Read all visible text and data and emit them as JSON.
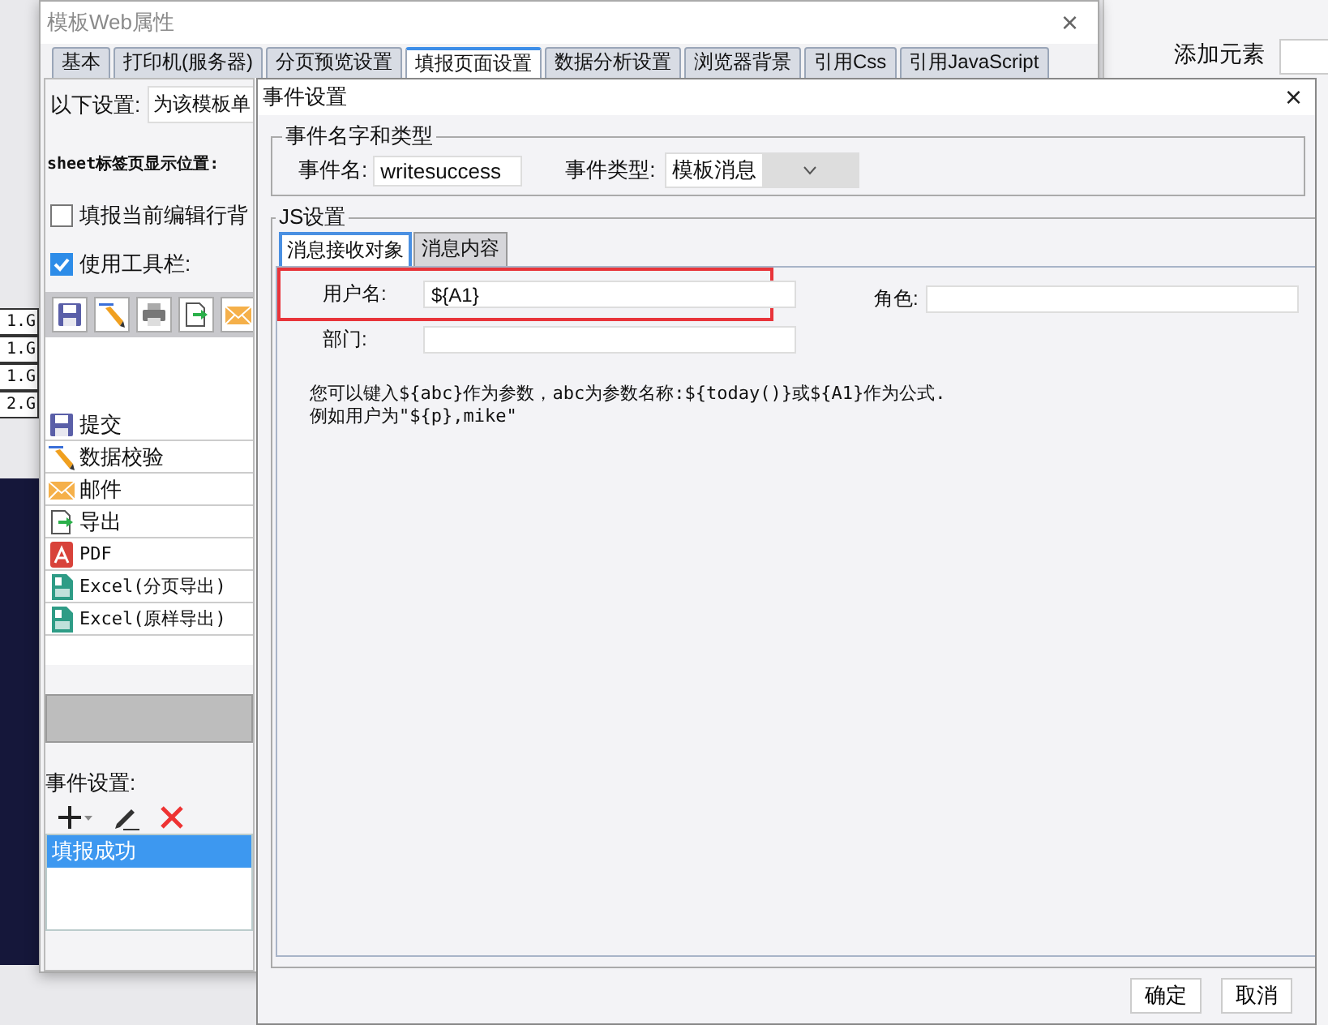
{
  "background_app": {
    "panel_label": "添加元素",
    "cells": [
      "1.G",
      "1.G",
      "1.G",
      "2.G"
    ]
  },
  "properties_window": {
    "title": "模板Web属性",
    "close_label": "×",
    "tabs": [
      {
        "label": "基本",
        "selected": false
      },
      {
        "label": "打印机(服务器)",
        "selected": false
      },
      {
        "label": "分页预览设置",
        "selected": false
      },
      {
        "label": "填报页面设置",
        "selected": true
      },
      {
        "label": "数据分析设置",
        "selected": false
      },
      {
        "label": "浏览器背景",
        "selected": false
      },
      {
        "label": "引用Css",
        "selected": false
      },
      {
        "label": "引用JavaScript",
        "selected": false
      }
    ],
    "settings_label": "以下设置:",
    "settings_value": "为该模板单",
    "sheet_position_label": "sheet标签页显示位置:",
    "checkboxes": [
      {
        "label": "填报当前编辑行背",
        "checked": false
      },
      {
        "label": "使用工具栏:",
        "checked": true
      }
    ],
    "toolbar": [
      {
        "kind": "submit"
      },
      {
        "kind": "verify"
      },
      {
        "kind": "print"
      },
      {
        "kind": "export"
      },
      {
        "kind": "email"
      }
    ],
    "buttons": [
      {
        "label": "提交",
        "kind": "submit"
      },
      {
        "label": "数据校验",
        "kind": "verify"
      },
      {
        "label": "邮件",
        "kind": "email"
      },
      {
        "label": "导出",
        "kind": "export"
      },
      {
        "label": "PDF",
        "kind": "pdf"
      },
      {
        "label": "Excel(分页导出)",
        "kind": "excel"
      },
      {
        "label": "Excel(原样导出)",
        "kind": "excel"
      }
    ],
    "events_label": "事件设置:",
    "events": [
      {
        "label": "填报成功",
        "selected": true
      }
    ]
  },
  "event_dialog": {
    "title": "事件设置",
    "close_label": "×",
    "name_group": {
      "legend": "事件名字和类型",
      "name_label": "事件名:",
      "name_value": "writesuccess",
      "type_label": "事件类型:",
      "type_value": "模板消息"
    },
    "js_group": {
      "legend": "JS设置",
      "tabs": [
        {
          "label": "消息接收对象",
          "selected": true
        },
        {
          "label": "消息内容",
          "selected": false
        }
      ],
      "fields": [
        {
          "label": "用户名:",
          "value": "${A1}",
          "highlighted": true
        },
        {
          "label": "角色:",
          "highlighted": false
        },
        {
          "label": "部门:",
          "highlighted": false
        }
      ],
      "help": [
        "您可以键入${abc}作为参数，abc为参数名称:${today()}或${A1}作为公式.",
        "例如用户为\"${p},mike\""
      ]
    },
    "buttons": [
      "确定",
      "取消"
    ]
  }
}
